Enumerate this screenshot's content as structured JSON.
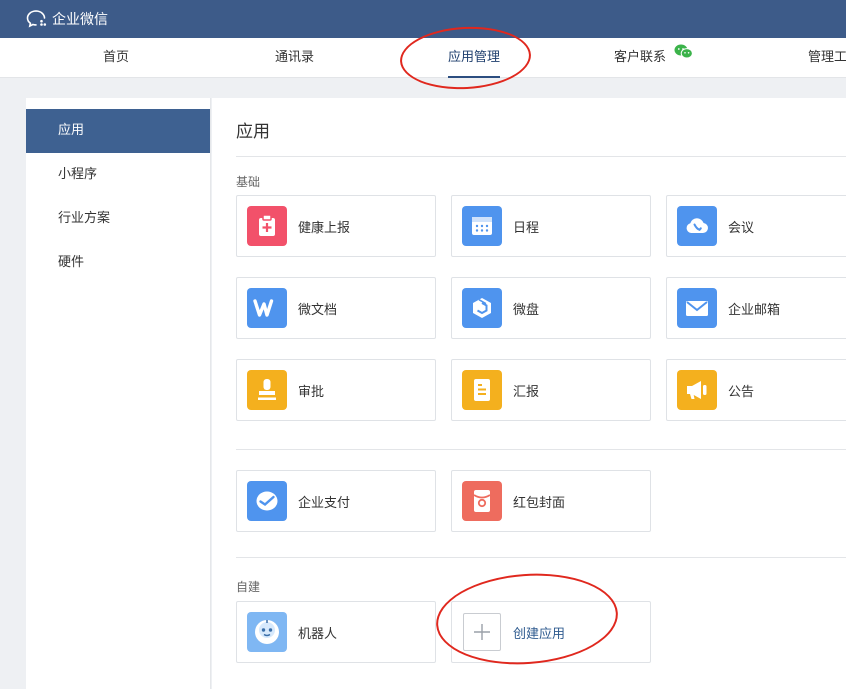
{
  "app": {
    "title": "企业微信"
  },
  "nav": {
    "home": "首页",
    "contacts": "通讯录",
    "apps": "应用管理",
    "customer": "客户联系",
    "manage": "管理工"
  },
  "sidebar": {
    "items": [
      {
        "label": "应用",
        "active": true
      },
      {
        "label": "小程序"
      },
      {
        "label": "行业方案"
      },
      {
        "label": "硬件"
      }
    ]
  },
  "main": {
    "title": "应用",
    "section_basic": "基础",
    "section_custom": "自建",
    "apps": [
      {
        "label": "健康上报",
        "icon": "health-report-icon",
        "color": "#f2516a"
      },
      {
        "label": "日程",
        "icon": "calendar-icon",
        "color": "#4f94ee"
      },
      {
        "label": "会议",
        "icon": "meeting-icon",
        "color": "#4f94ee"
      },
      {
        "label": "微文档",
        "icon": "document-icon",
        "color": "#4f94ee"
      },
      {
        "label": "微盘",
        "icon": "drive-icon",
        "color": "#4f94ee"
      },
      {
        "label": "企业邮箱",
        "icon": "mail-icon",
        "color": "#4f94ee"
      },
      {
        "label": "审批",
        "icon": "approval-icon",
        "color": "#f4b01e"
      },
      {
        "label": "汇报",
        "icon": "report-icon",
        "color": "#f4b01e"
      },
      {
        "label": "公告",
        "icon": "announcement-icon",
        "color": "#f4b01e"
      }
    ],
    "pay_apps": [
      {
        "label": "企业支付",
        "icon": "payment-icon",
        "color": "#4f94ee"
      },
      {
        "label": "红包封面",
        "icon": "red-packet-icon",
        "color": "#ee6c5e"
      }
    ],
    "custom_apps": [
      {
        "label": "机器人",
        "icon": "robot-icon",
        "color": "#7fb7f3"
      }
    ],
    "create_label": "创建应用"
  }
}
